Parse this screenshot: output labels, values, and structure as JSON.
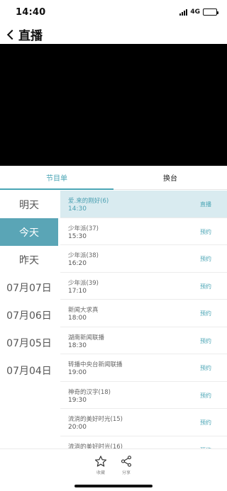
{
  "status_bar": {
    "time": "14:40",
    "network": "4G"
  },
  "nav": {
    "title": "直播"
  },
  "tabs": [
    {
      "label": "节目单",
      "active": true
    },
    {
      "label": "换台",
      "active": false
    }
  ],
  "days": [
    {
      "label": "明天",
      "selected": false
    },
    {
      "label": "今天",
      "selected": true
    },
    {
      "label": "昨天",
      "selected": false
    },
    {
      "label": "07月07日",
      "selected": false
    },
    {
      "label": "07月06日",
      "selected": false
    },
    {
      "label": "07月05日",
      "selected": false
    },
    {
      "label": "07月04日",
      "selected": false
    }
  ],
  "programs": [
    {
      "name": "爱.来的刚好(6)",
      "time": "14:30",
      "action": "直播",
      "live": true
    },
    {
      "name": "少年派(37)",
      "time": "15:30",
      "action": "预约",
      "live": false
    },
    {
      "name": "少年派(38)",
      "time": "16:20",
      "action": "预约",
      "live": false
    },
    {
      "name": "少年派(39)",
      "time": "17:10",
      "action": "预约",
      "live": false
    },
    {
      "name": "新闻大求真",
      "time": "18:00",
      "action": "预约",
      "live": false
    },
    {
      "name": "湖南新闻联播",
      "time": "18:30",
      "action": "预约",
      "live": false
    },
    {
      "name": "转播中央台新闻联播",
      "time": "19:00",
      "action": "预约",
      "live": false
    },
    {
      "name": "神奇的汉字(18)",
      "time": "19:30",
      "action": "预约",
      "live": false
    },
    {
      "name": "流淌的美好时光(15)",
      "time": "20:00",
      "action": "预约",
      "live": false
    },
    {
      "name": "流淌的美好时光(16)",
      "time": "",
      "action": "预约",
      "live": false
    }
  ],
  "bottom_bar": {
    "collect_label": "收藏",
    "share_label": "分享"
  },
  "colors": {
    "accent": "#4aa5b5",
    "selected_day_bg": "#5aa5b6",
    "live_row_bg": "#d9ebf0"
  },
  "icons": {
    "collect": "star-icon",
    "share": "share-icon",
    "back": "chevron-left-icon"
  }
}
